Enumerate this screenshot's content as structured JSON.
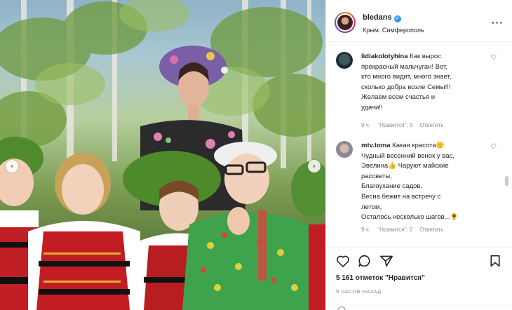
{
  "post": {
    "username": "bledans",
    "location": "Крым. Симферополь",
    "verified": true
  },
  "comments": [
    {
      "username": "lidiakolotyhina",
      "lines": [
        "Как вырос",
        "прекрасный мальчуган! Вот,",
        "кто много видит, много знает,",
        "сколько добра возле Семы!!!",
        "Желаем всем счастья и",
        "удачи!!"
      ],
      "time": "9 ч.",
      "likes": "\"Нравится\": 3",
      "reply": "Ответить"
    },
    {
      "username": "mtv.toma",
      "lines": [
        "Какая красота🙂",
        "Чудный весенний венок у вас,",
        "Эвелина👍 Чаруют майские",
        "рассветы,",
        "Благоухание садов,",
        "Весна бежит на встречу с",
        "летом,",
        "Осталось несколько шагов...🌻"
      ],
      "time": "9 ч.",
      "likes": "\"Нравится\": 2",
      "reply": "Ответить"
    }
  ],
  "actions": {
    "likes_count": "5 161 отметок \"Нравится\"",
    "timestamp": "9 ЧАСОВ НАЗАД"
  },
  "icons": {
    "more": "more-options-icon",
    "heart": "heart-icon",
    "comment": "comment-icon",
    "share": "share-icon",
    "save": "bookmark-icon",
    "prev": "chevron-left-icon",
    "next": "chevron-right-icon"
  },
  "colors": {
    "verified": "#3897f0",
    "muted": "#8e8e8e",
    "text": "#262626",
    "border": "#efefef"
  }
}
